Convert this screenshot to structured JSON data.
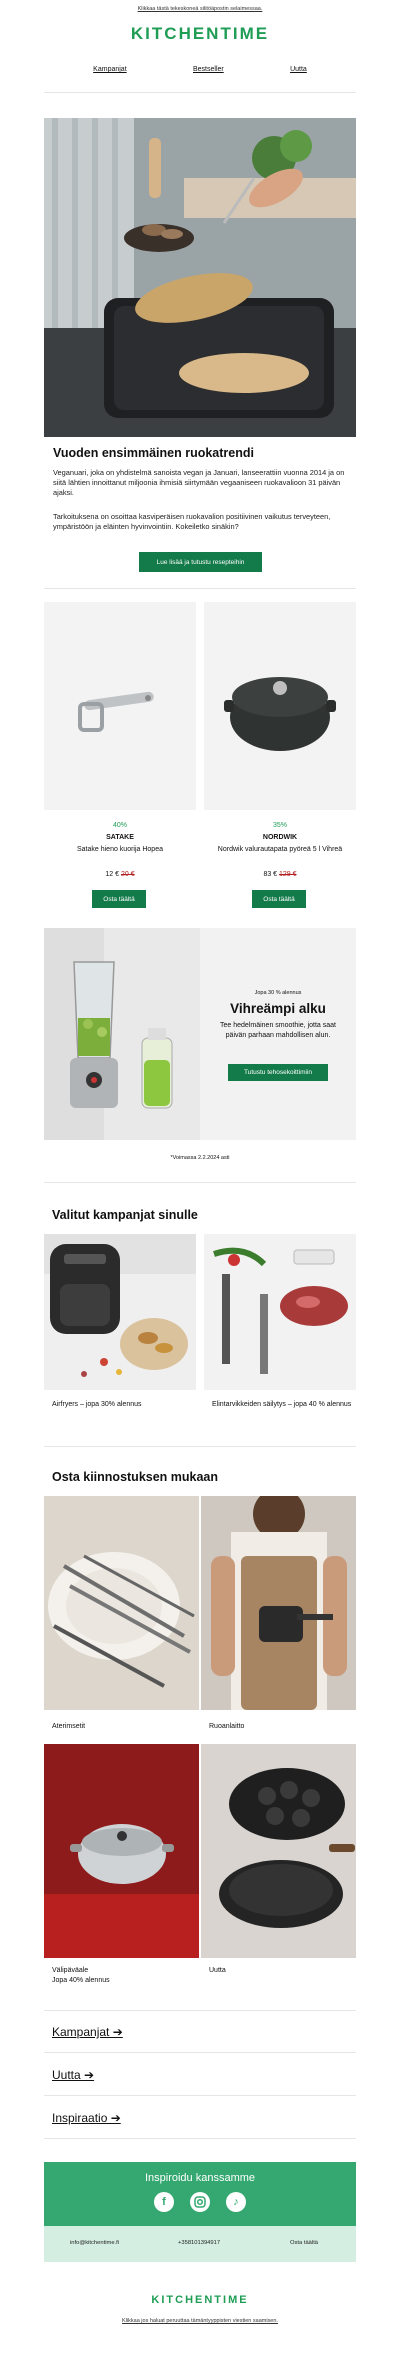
{
  "header": {
    "top_note": "Klikkaa tästä tekeskoneä silitöäpostin selaimessaa.",
    "logo": "KITCHENTIME",
    "nav": [
      "Kampanjat",
      "Bestseller",
      "Uutta"
    ]
  },
  "hero": {
    "title": "Vuoden ensimmäinen ruokatrendi",
    "para1": "Veganuari, joka on yhdistelmä sanoista vegan ja Januari, lanseerattiin vuonna 2014 ja on siitä lähtien innoittanut miljoonia ihmisiä siirtymään vegaaniseen ruokavalioon 31 päivän ajaksi.",
    "para2": "Tarkoituksena on osoittaa kasviperäisen ruokavalion positiivinen vaikutus terveyteen, ympäristöön ja eläinten hyvinvointiin. Kokeiletko sinäkin?",
    "button": "Lue lisää ja tutustu resepteihin"
  },
  "products": [
    {
      "pct": "40%",
      "brand": "SATAKE",
      "name": "Satake hieno kuorija Hopea",
      "price": "12 €",
      "old_price": "20 €",
      "button": "Osta täältä"
    },
    {
      "pct": "35%",
      "brand": "NORDWIK",
      "name": "Nordwik valurautapata pyöreä 5 l Vihreä",
      "price": "83 €",
      "old_price": "129 €",
      "button": "Osta täältä"
    }
  ],
  "promo": {
    "small": "Jopa 30 % alennus",
    "title": "Vihreämpi alku",
    "text": "Tee hedelmäinen smoothie, jotta saat päivän parhaan mahdollisen alun.",
    "button": "Tutustu tehosekoittimiin",
    "footnote": "*Voimassa 2.2.2024 asti"
  },
  "campaigns": {
    "title": "Valitut kampanjat sinulle",
    "items": [
      "Airfryers – jopa 30% alennus",
      "Elintarvikkeiden säilytys – jopa 40 % alennus"
    ]
  },
  "interests": {
    "title": "Osta kiinnostuksen mukaan",
    "items": [
      "Aterimsetit",
      "Ruoanlaitto",
      "Välipäväale\nJopa 40% alennus",
      "Uutta"
    ]
  },
  "links": [
    "Kampanjat ➔",
    "Uutta ➔",
    "Inspiraatio ➔"
  ],
  "footer": {
    "inspire": "Inspiroidu kanssamme",
    "icons": [
      "facebook-icon",
      "instagram-icon",
      "tiktok-icon"
    ],
    "email": "info@kitchentime.fi",
    "phone": "+358101394917",
    "shop": "Osta täältä",
    "logo": "KITCHENTIME",
    "bottom_note": "Klikkaa jos haluat peruuttaa tämäntyyppisten viestien saamisen."
  },
  "colors": {
    "brand_green": "#1f9d55",
    "button_green": "#137a4a",
    "footer_green": "#34a870"
  }
}
